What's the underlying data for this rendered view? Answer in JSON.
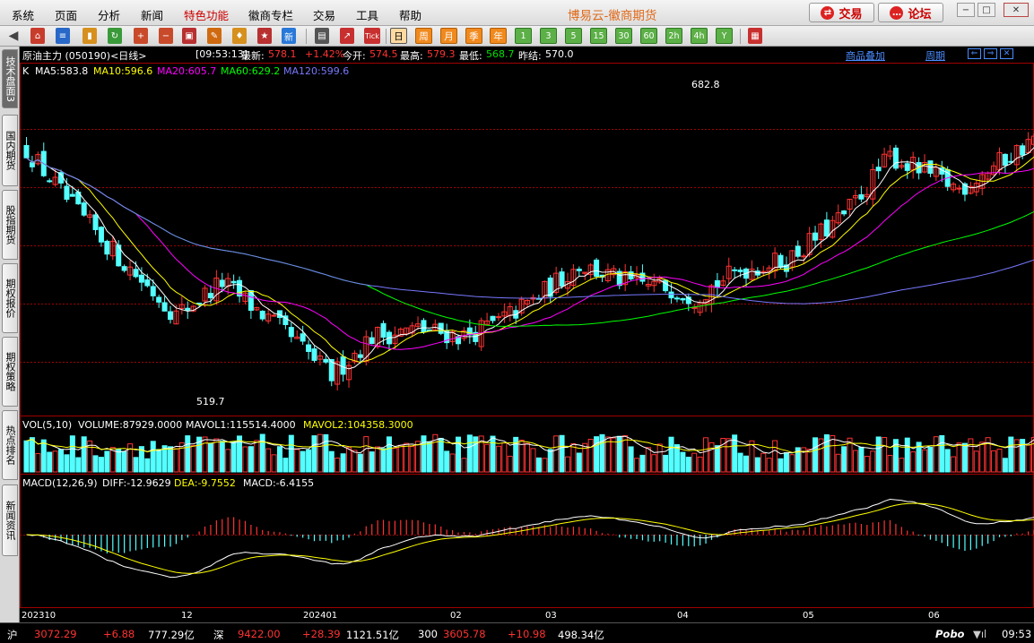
{
  "menu": [
    "系统",
    "页面",
    "分析",
    "新闻",
    "特色功能",
    "徽商专栏",
    "交易",
    "工具",
    "帮助"
  ],
  "window_title": "博易云-徽商期货",
  "trade_button": "交易",
  "forum_button": "论坛",
  "toolbar": {
    "periods": [
      "日",
      "周",
      "月",
      "季",
      "年"
    ],
    "minutes": [
      "1",
      "3",
      "5",
      "15",
      "30",
      "60",
      "2h",
      "4h",
      "Y"
    ]
  },
  "side_tabs": [
    "技术盘面",
    "国内期货",
    "股指期货",
    "期权报价",
    "期权策略",
    "热点排名",
    "新闻资讯"
  ],
  "side_tab_numbers": [
    "3"
  ],
  "info": {
    "name": "原油主力 (050190)<日线>",
    "time": "[09:53:13]",
    "latest_label": "最新:",
    "latest": "578.1",
    "change": "+1.42%",
    "open_label": "今开:",
    "open": "574.5",
    "high_label": "最高:",
    "high": "579.3",
    "low_label": "最低:",
    "low": "568.7",
    "prev_label": "昨结:",
    "prev": "570.0",
    "overlay": "商品叠加",
    "period": "周期"
  },
  "ma_legend": {
    "k": "K",
    "ma5": "MA5:583.8",
    "ma10": "MA10:596.6",
    "ma20": "MA20:605.7",
    "ma60": "MA60:629.2",
    "ma120": "MA120:599.6"
  },
  "vol_legend": {
    "title": "VOL(5,10)",
    "volume": "VOLUME:87929.0000",
    "mavol1": "MAVOL1:115514.4000",
    "mavol2": "MAVOL2:104358.3000"
  },
  "macd_legend": {
    "title": "MACD(12,26,9)",
    "diff": "DIFF:-12.9629",
    "dea": "DEA:-9.7552",
    "macd": "MACD:-6.4155"
  },
  "colors": {
    "up": "#ff3232",
    "down": "#54ffff",
    "ma5": "#ffffff",
    "ma10": "#ffff00",
    "ma20": "#ff00ff",
    "ma60": "#00ff00",
    "ma120": "#7878ff",
    "grid": "#a00000"
  },
  "chart_data": {
    "type": "candlestick",
    "title": "原油主力 (050190) 日线",
    "y_range": [
      505,
      700
    ],
    "high_annotation": "682.8",
    "low_annotation": "519.7",
    "x_ticks": [
      "202310",
      "12",
      "202401",
      "02",
      "03",
      "04",
      "05",
      "06"
    ],
    "last": {
      "open": 574.5,
      "high": 579.3,
      "low": 568.7,
      "close": 578.1,
      "prev_settle": 570.0
    }
  },
  "status": {
    "sh_label": "沪",
    "sh_value": "3072.29",
    "sh_change": "+6.88",
    "sh_amount": "777.29亿",
    "sz_label": "深",
    "sz_value": "9422.00",
    "sz_change": "+28.39",
    "sz_amount": "1121.51亿",
    "i300_label": "300",
    "i300_value": "3605.78",
    "i300_change": "+10.98",
    "i300_amount": "498.34亿",
    "brand": "Pobo",
    "clock": "09:53"
  }
}
